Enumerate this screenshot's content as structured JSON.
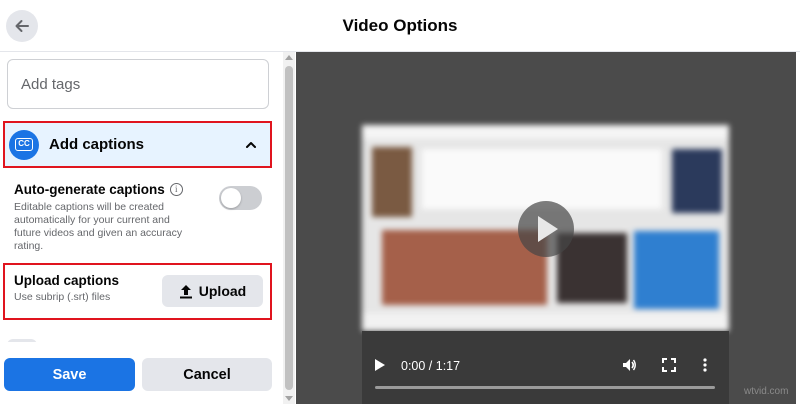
{
  "header": {
    "title": "Video Options",
    "back_icon": "arrow-left-icon"
  },
  "tags": {
    "placeholder": "Add tags",
    "value": ""
  },
  "captions": {
    "section_label": "Add captions",
    "badge_text": "CC",
    "auto_generate": {
      "title": "Auto-generate captions",
      "description": "Editable captions will be created automatically for your current and future videos and given an accuracy rating.",
      "enabled": false
    },
    "upload": {
      "title": "Upload captions",
      "description": "Use subrip (.srt) files",
      "button_label": "Upload"
    }
  },
  "footer": {
    "save_label": "Save",
    "cancel_label": "Cancel"
  },
  "video": {
    "time_display": "0:00 / 1:17"
  },
  "watermark": "wtvid.com",
  "colors": {
    "accent": "#1b74e4",
    "highlight_border": "#e0141e",
    "section_bg": "#e7f3ff",
    "button_gray": "#e4e6eb"
  }
}
